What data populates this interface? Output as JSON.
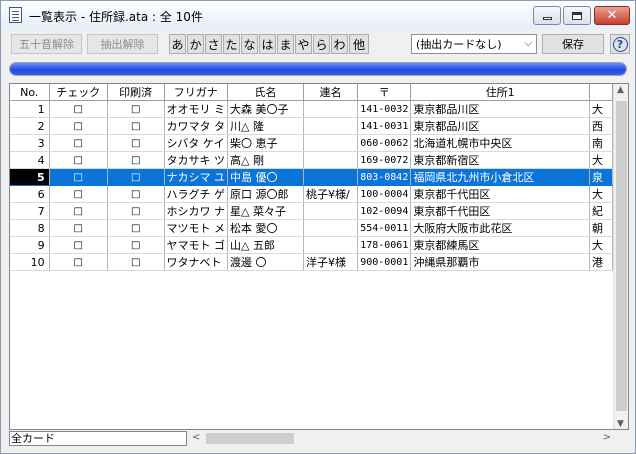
{
  "window": {
    "title": "一覧表示 - 住所録.ata : 全 10件",
    "minimize_icon": "minimize-icon",
    "maximize_icon": "maximize-icon",
    "close_icon": "close-icon"
  },
  "toolbar": {
    "gojuon_reset_label": "五十音解除",
    "extract_reset_label": "抽出解除",
    "kana_tabs": [
      "あ",
      "か",
      "さ",
      "た",
      "な",
      "は",
      "ま",
      "や",
      "ら",
      "わ",
      "他"
    ],
    "extract_select_value": "(抽出カードなし)",
    "save_label": "保存",
    "help_label": "?"
  },
  "progress": {
    "fraction": 1.0,
    "color": "#1d4ae0"
  },
  "table": {
    "columns": [
      "No.",
      "チェック",
      "印刷済",
      "フリガナ",
      "氏名",
      "連名",
      "〒",
      "住所1",
      ""
    ],
    "selected_row_index": 4,
    "rows": [
      [
        "1",
        "□",
        "□",
        "オオモリ ミ",
        "大森 美〇子",
        "",
        "141-0032",
        "東京都品川区",
        "大"
      ],
      [
        "2",
        "□",
        "□",
        "カワマタ タ",
        "川△ 隆",
        "",
        "141-0031",
        "東京都品川区",
        "西"
      ],
      [
        "3",
        "□",
        "□",
        "シバタ ケイ",
        "柴〇 恵子",
        "",
        "060-0062",
        "北海道札幌市中央区",
        "南"
      ],
      [
        "4",
        "□",
        "□",
        "タカサキ ツ",
        "高△ 剛",
        "",
        "169-0072",
        "東京都新宿区",
        "大"
      ],
      [
        "5",
        "□",
        "□",
        "ナカシマ ユ",
        "中島 優〇",
        "",
        "803-0842",
        "福岡県北九州市小倉北区",
        "泉"
      ],
      [
        "6",
        "□",
        "□",
        "ハラグチ ゲ",
        "原口 源〇郎",
        "桃子¥様/",
        "100-0004",
        "東京都千代田区",
        "大"
      ],
      [
        "7",
        "□",
        "□",
        "ホシカワ ナ",
        "星△ 菜々子",
        "",
        "102-0094",
        "東京都千代田区",
        "紀"
      ],
      [
        "8",
        "□",
        "□",
        "マツモト メ",
        "松本 愛〇",
        "",
        "554-0011",
        "大阪府大阪市此花区",
        "朝"
      ],
      [
        "9",
        "□",
        "□",
        "ヤマモト ゴ",
        "山△ 五郎",
        "",
        "178-0061",
        "東京都練馬区",
        "大"
      ],
      [
        "10",
        "□",
        "□",
        "ワタナベト",
        "渡邊 〇",
        "洋子¥様",
        "900-0001",
        "沖縄県那覇市",
        "港"
      ]
    ]
  },
  "status": {
    "value": "全カード"
  }
}
